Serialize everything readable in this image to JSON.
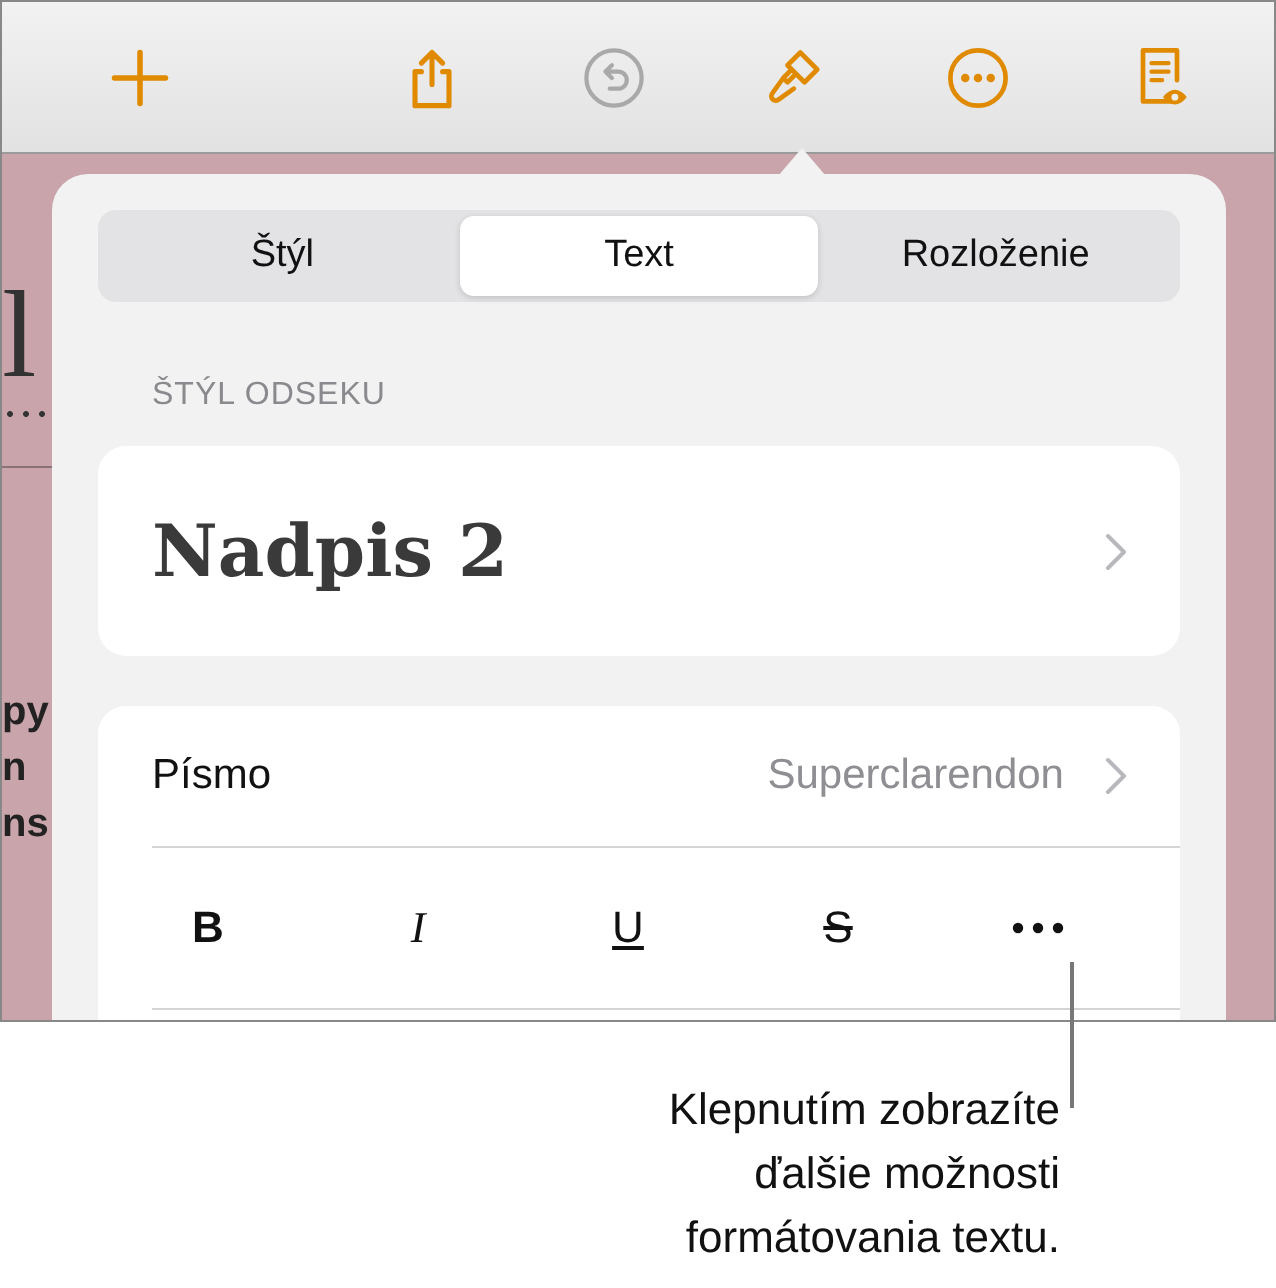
{
  "toolbar": {
    "items": [
      {
        "kind": "add",
        "disabled": false
      },
      {
        "kind": "share",
        "disabled": false
      },
      {
        "kind": "undo",
        "disabled": true
      },
      {
        "kind": "format",
        "disabled": false
      },
      {
        "kind": "more",
        "disabled": false
      },
      {
        "kind": "reader",
        "disabled": false
      }
    ]
  },
  "document": {
    "heading_fragment": "l",
    "lines": [
      "py",
      "n",
      "ns"
    ]
  },
  "popover": {
    "tabs": [
      {
        "label": "Štýl",
        "selected": false
      },
      {
        "label": "Text",
        "selected": true
      },
      {
        "label": "Rozloženie",
        "selected": false
      }
    ],
    "section_label": "ŠTÝL ODSEKU",
    "paragraph_style": {
      "value": "Nadpis 2"
    },
    "font": {
      "label": "Písmo",
      "value": "Superclarendon"
    },
    "format_buttons": [
      {
        "kind": "bold",
        "label": "B"
      },
      {
        "kind": "italic",
        "label": "I"
      },
      {
        "kind": "underline",
        "label": "U"
      },
      {
        "kind": "strikethrough",
        "label": "S"
      },
      {
        "kind": "more"
      }
    ]
  },
  "callout": {
    "lines": [
      "Klepnutím zobrazíte",
      "ďalšie možnosti",
      "formátovania textu."
    ]
  }
}
